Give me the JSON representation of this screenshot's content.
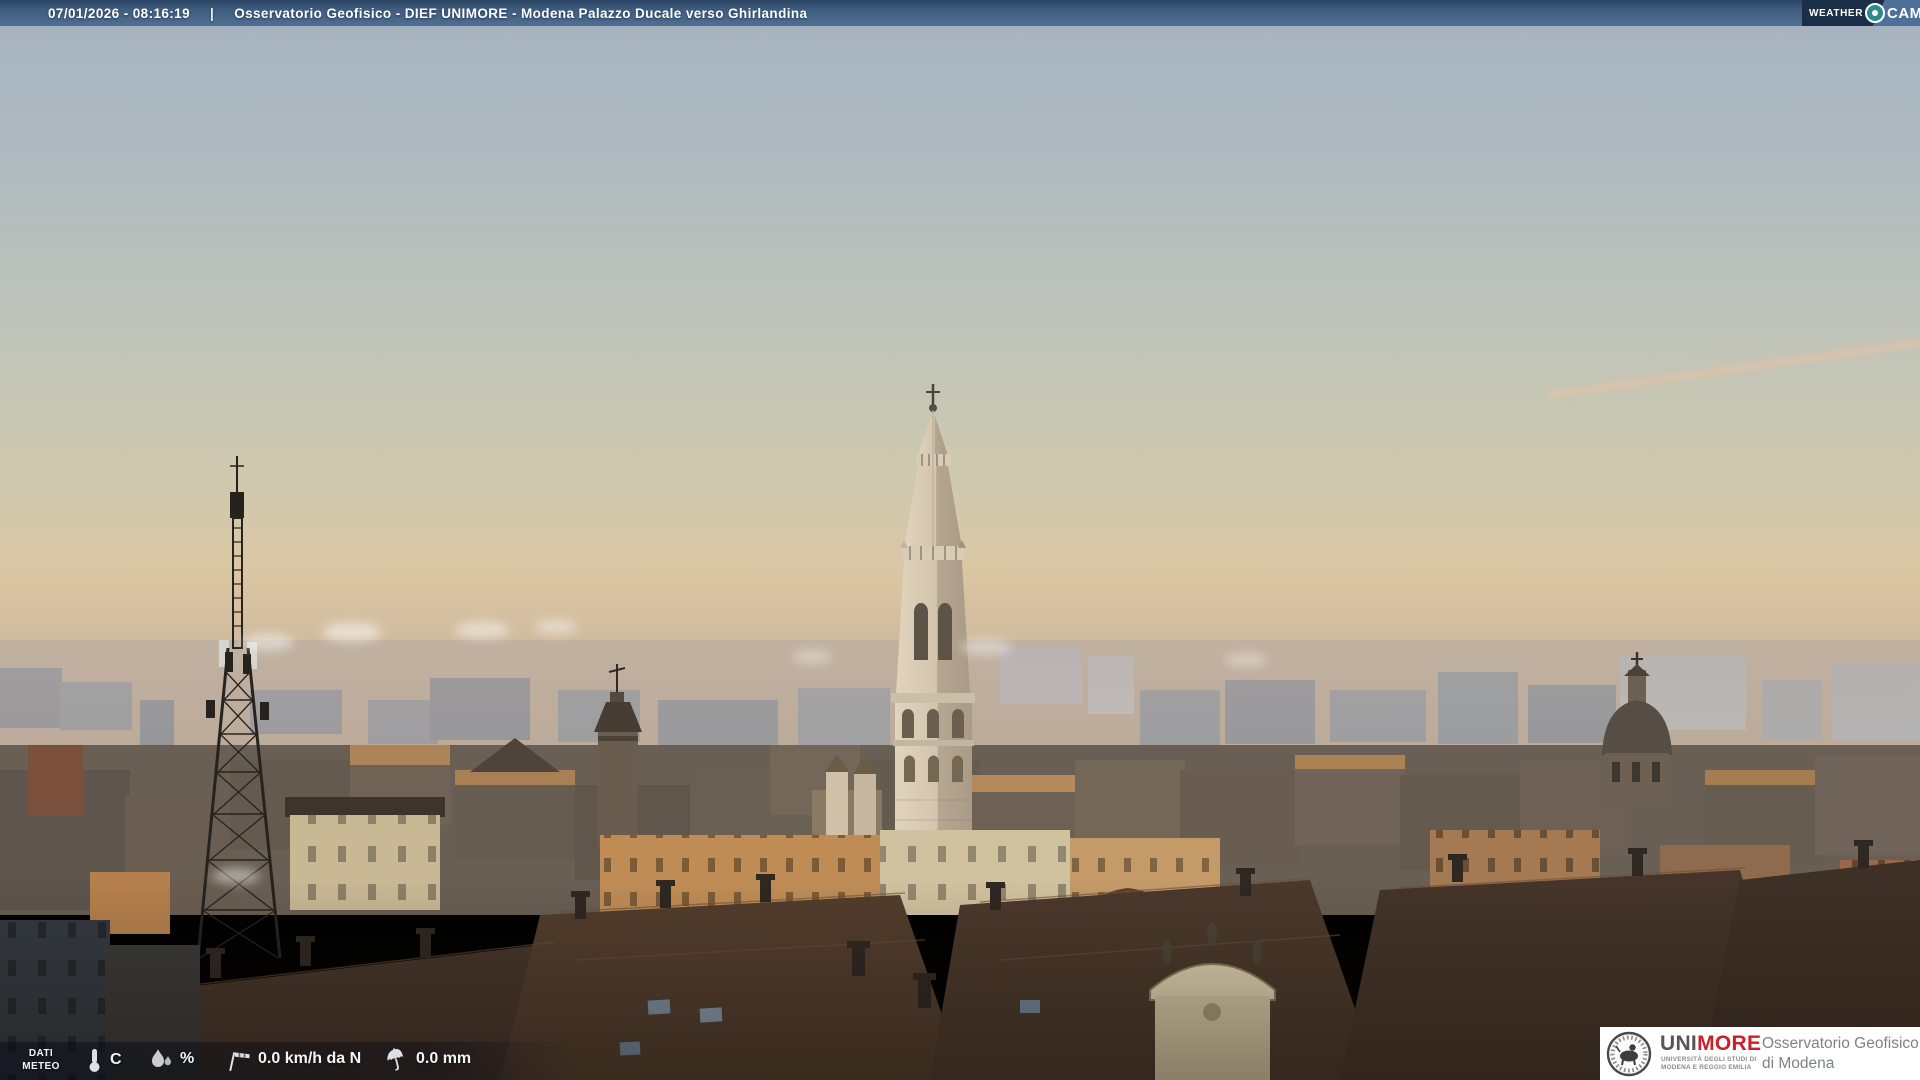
{
  "header": {
    "datetime": "07/01/2026 - 08:16:19",
    "separator": "|",
    "title": "Osservatorio Geofisico - DIEF UNIMORE - Modena Palazzo Ducale verso Ghirlandina"
  },
  "weathercam_logo": {
    "weather": "WEATHER",
    "cam": "CAM"
  },
  "meteo": {
    "label_line1": "DATI",
    "label_line2": "METEO",
    "temperature_unit": "C",
    "humidity_unit": "%",
    "wind_value": "0.0 km/h da N",
    "rain_value": "0.0 mm"
  },
  "unimore": {
    "uni": "UNI",
    "more": "MORE",
    "subtitle_line1": "UNIVERSITÀ DEGLI STUDI DI",
    "subtitle_line2": "MODENA E REGGIO EMILIA",
    "org_line1": "Osservatorio Geofisico",
    "org_line2": "di Modena"
  },
  "colors": {
    "topbar_blue": "#4e6f94",
    "topbar_navy": "#2b4565",
    "logo_navy": "#1b2e47",
    "logo_steel_blue": "#4c7099",
    "lens_teal": "#2e8b88",
    "unimore_red": "#cc2028",
    "unimore_gray": "#55565a",
    "org_text_gray": "#7e8387",
    "sky_top": "#a5b2c0",
    "sky_horizon": "#dfc49c",
    "haze": "#a39a9b"
  }
}
